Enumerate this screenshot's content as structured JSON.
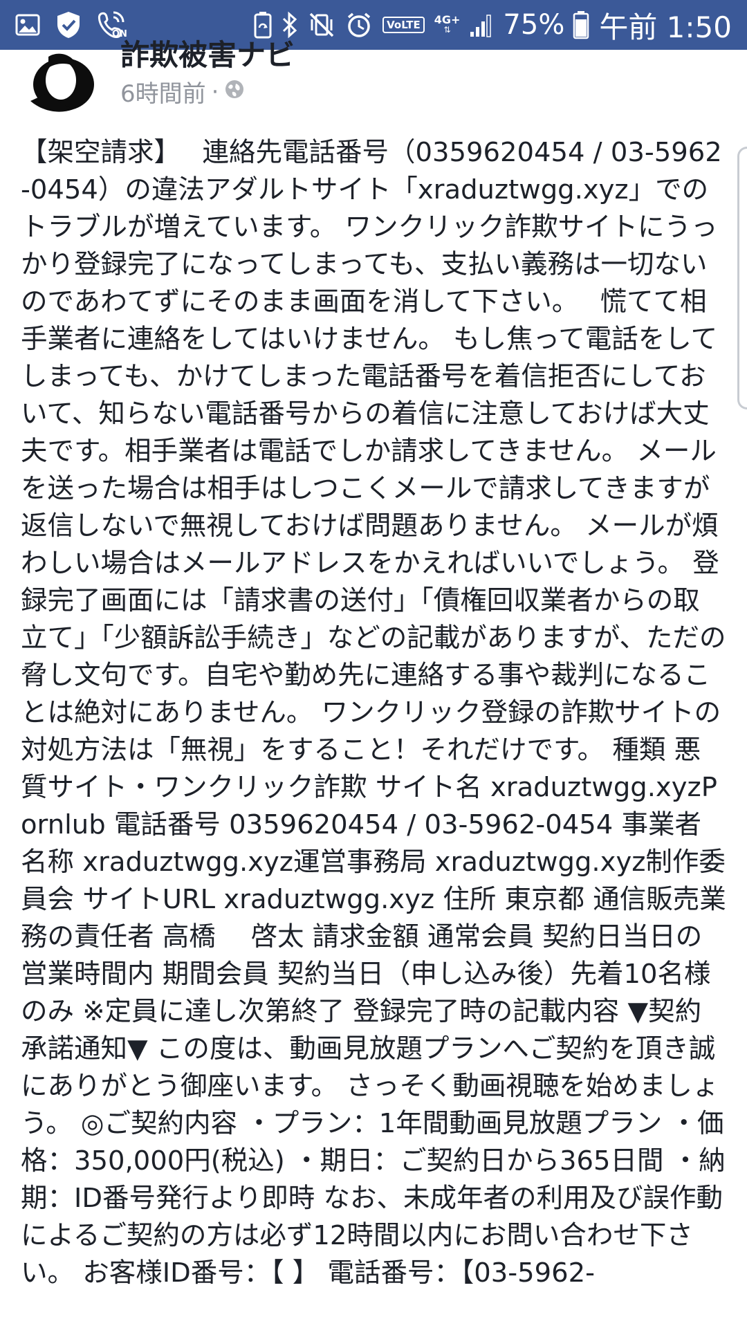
{
  "status_bar": {
    "background": "#3b5998",
    "left_icons": [
      "image-icon",
      "shield-check-icon",
      "wifi-calling-icon"
    ],
    "wifi_calling_label": "ON",
    "right_icons": [
      "battery-saver-icon",
      "bluetooth-icon",
      "vibrate-mute-icon",
      "alarm-icon",
      "volte-icon",
      "network-4g-icon",
      "signal-icon",
      "battery-icon"
    ],
    "volte_label": "VoLTE",
    "network_label": "4G+",
    "battery_percent": "75%",
    "time": "午前 1:50"
  },
  "post": {
    "author": "詐欺被害ナビ",
    "time_ago": "6時間前",
    "separator": "·",
    "privacy_icon": "globe-icon",
    "body": "【架空請求】　 連絡先電話番号（0359620454 / 03-5962-0454）の違法アダルトサイト「xraduztwgg.xyz」でのトラブルが増えています。 ワンクリック詐欺サイトにうっかり登録完了になってしまっても、支払い義務は一切ないのであわてずにそのまま画面を消して下さい。　 慌てて相手業者に連絡をしてはいけません。 もし焦って電話をしてしまっても、かけてしまった電話番号を着信拒否にしておいて、知らない電話番号からの着信に注意しておけば大丈夫です。相手業者は電話でしか請求してきません。 メールを送った場合は相手はしつこくメールで請求してきますが返信しないで無視しておけば問題ありません。 メールが煩わしい場合はメールアドレスをかえればいいでしょう。 登録完了画面には「請求書の送付」「債権回収業者からの取立て」「少額訴訟手続き」などの記載がありますが、ただの脅し文句です。自宅や勤め先に連絡する事や裁判になることは絶対にありません。 ワンクリック登録の詐欺サイトの対処方法は「無視」をすること！それだけです。 種類 悪質サイト・ワンクリック詐欺 サイト名 xraduztwgg.xyzPornlub 電話番号 0359620454 / 03-5962-0454 事業者名称 xraduztwgg.xyz運営事務局 xraduztwgg.xyz制作委員会 サイトURL xraduztwgg.xyz 住所 東京都 通信販売業務の責任者 高橋　 啓太 請求金額 通常会員 契約日当日の営業時間内 期間会員 契約当日（申し込み後）先着10名様のみ ※定員に達し次第終了 登録完了時の記載内容 ▼契約承諾通知▼ この度は、動画見放題プランへご契約を頂き誠にありがとう御座います。 さっそく動画視聴を始めましょう。 ◎ご契約内容 ・プラン：1年間動画見放題プラン ・価格：350,000円(税込) ・期日：ご契約日から365日間 ・納期：ID番号発行より即時 なお、未成年者の利用及び誤作動によるご契約の方は必ず12時間以内にお問い合わせ下さい。 お客様ID番号：【 】 電話番号：【03-5962-"
  }
}
